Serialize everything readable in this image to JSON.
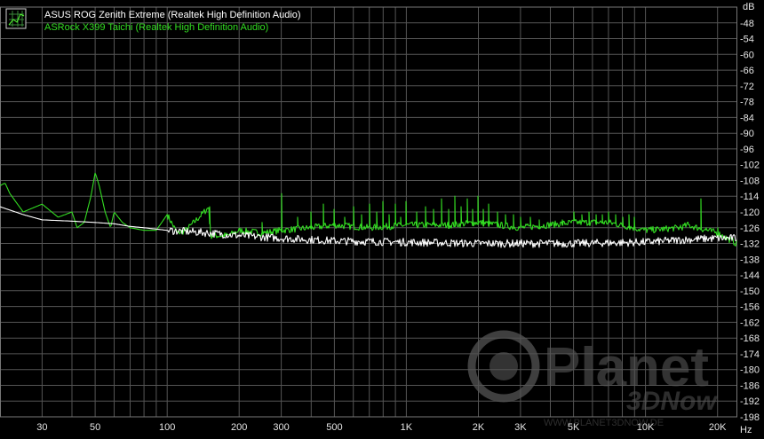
{
  "chart_data": {
    "type": "line",
    "xscale": "log",
    "xlim": [
      20,
      24000
    ],
    "ylim": [
      -198,
      -42
    ],
    "yunit": "dB",
    "xunit": "Hz",
    "grid": true,
    "legend": "top-left",
    "x_ticks": [
      {
        "value": 30,
        "label": "30"
      },
      {
        "value": 50,
        "label": "50"
      },
      {
        "value": 100,
        "label": "100"
      },
      {
        "value": 200,
        "label": "200"
      },
      {
        "value": 300,
        "label": "300"
      },
      {
        "value": 500,
        "label": "500"
      },
      {
        "value": 1000,
        "label": "1K"
      },
      {
        "value": 2000,
        "label": "2K"
      },
      {
        "value": 3000,
        "label": "3K"
      },
      {
        "value": 5000,
        "label": "5K"
      },
      {
        "value": 10000,
        "label": "10K"
      },
      {
        "value": 20000,
        "label": "20K"
      }
    ],
    "y_ticks": [
      -48,
      -54,
      -60,
      -66,
      -72,
      -78,
      -84,
      -90,
      -96,
      -102,
      -108,
      -114,
      -120,
      -126,
      -132,
      -138,
      -144,
      -150,
      -156,
      -162,
      -168,
      -174,
      -180,
      -186,
      -192,
      -198
    ],
    "series": [
      {
        "name": "ASUS ROG Zenith Extreme (Realtek High Definition Audio)",
        "color": "#ffffff",
        "points": [
          [
            20,
            -118
          ],
          [
            25,
            -121
          ],
          [
            30,
            -123
          ],
          [
            40,
            -123.5
          ],
          [
            50,
            -124
          ],
          [
            60,
            -124.5
          ],
          [
            70,
            -125.5
          ],
          [
            80,
            -126
          ],
          [
            100,
            -127
          ],
          [
            150,
            -128
          ],
          [
            200,
            -129
          ],
          [
            300,
            -130
          ],
          [
            500,
            -131
          ],
          [
            1000,
            -131.5
          ],
          [
            2000,
            -132
          ],
          [
            3000,
            -132
          ],
          [
            5000,
            -132
          ],
          [
            10000,
            -131.5
          ],
          [
            15000,
            -130.5
          ],
          [
            20000,
            -130
          ],
          [
            24000,
            -130
          ]
        ]
      },
      {
        "name": "ASRock X399 Taichi (Realtek High Definition Audio)",
        "color": "#33dd22",
        "points": [
          [
            20,
            -110
          ],
          [
            21,
            -109
          ],
          [
            22,
            -113
          ],
          [
            25,
            -120
          ],
          [
            30,
            -117
          ],
          [
            35,
            -122
          ],
          [
            40,
            -120
          ],
          [
            42,
            -126
          ],
          [
            45,
            -124
          ],
          [
            48,
            -114
          ],
          [
            50,
            -105
          ],
          [
            52,
            -110
          ],
          [
            55,
            -120
          ],
          [
            58,
            -126
          ],
          [
            60,
            -120
          ],
          [
            65,
            -124
          ],
          [
            70,
            -126
          ],
          [
            80,
            -127
          ],
          [
            90,
            -127
          ],
          [
            100,
            -121
          ],
          [
            110,
            -128
          ],
          [
            120,
            -127
          ],
          [
            150,
            -118
          ],
          [
            151,
            -129
          ],
          [
            180,
            -129
          ],
          [
            200,
            -127
          ],
          [
            250,
            -128
          ],
          [
            300,
            -127
          ],
          [
            400,
            -126
          ],
          [
            500,
            -125
          ],
          [
            700,
            -126
          ],
          [
            1000,
            -125
          ],
          [
            1500,
            -125
          ],
          [
            2000,
            -124
          ],
          [
            3000,
            -126
          ],
          [
            5000,
            -124
          ],
          [
            7000,
            -124
          ],
          [
            10000,
            -127
          ],
          [
            14000,
            -126
          ],
          [
            15000,
            -125
          ],
          [
            20000,
            -128
          ],
          [
            24000,
            -132
          ]
        ],
        "spikes": [
          [
            100,
            -121
          ],
          [
            150,
            -118
          ],
          [
            200,
            -127
          ],
          [
            250,
            -124
          ],
          [
            300,
            -113
          ],
          [
            350,
            -122
          ],
          [
            400,
            -120
          ],
          [
            450,
            -117
          ],
          [
            500,
            -119
          ],
          [
            550,
            -122
          ],
          [
            600,
            -118
          ],
          [
            650,
            -121
          ],
          [
            700,
            -117
          ],
          [
            750,
            -120
          ],
          [
            800,
            -116
          ],
          [
            850,
            -121
          ],
          [
            900,
            -117
          ],
          [
            950,
            -122
          ],
          [
            1000,
            -116
          ],
          [
            1100,
            -120
          ],
          [
            1200,
            -118
          ],
          [
            1300,
            -119
          ],
          [
            1400,
            -115
          ],
          [
            1500,
            -119
          ],
          [
            1600,
            -114
          ],
          [
            1700,
            -118
          ],
          [
            1800,
            -115
          ],
          [
            1900,
            -119
          ],
          [
            2000,
            -114
          ],
          [
            2100,
            -119
          ],
          [
            2200,
            -117
          ],
          [
            2400,
            -120
          ],
          [
            2600,
            -121
          ],
          [
            2800,
            -121
          ],
          [
            3000,
            -122
          ],
          [
            3300,
            -122
          ],
          [
            3600,
            -123
          ],
          [
            4000,
            -124
          ],
          [
            4500,
            -123
          ],
          [
            5000,
            -120
          ],
          [
            5400,
            -121
          ],
          [
            5800,
            -120
          ],
          [
            6200,
            -121
          ],
          [
            6600,
            -121
          ],
          [
            7000,
            -120
          ],
          [
            7500,
            -121
          ],
          [
            8000,
            -122
          ],
          [
            8500,
            -121
          ],
          [
            9000,
            -122
          ],
          [
            10000,
            -126
          ],
          [
            11000,
            -126
          ],
          [
            12000,
            -127
          ],
          [
            13000,
            -126
          ],
          [
            14000,
            -125
          ],
          [
            15000,
            -124
          ],
          [
            16000,
            -126
          ],
          [
            17000,
            -115
          ],
          [
            18000,
            -126
          ],
          [
            20000,
            -126
          ]
        ]
      }
    ]
  },
  "watermark": {
    "title": "Planet",
    "sub": "3DNow",
    "url": "WWW.PLANET3DNOW.DE"
  }
}
